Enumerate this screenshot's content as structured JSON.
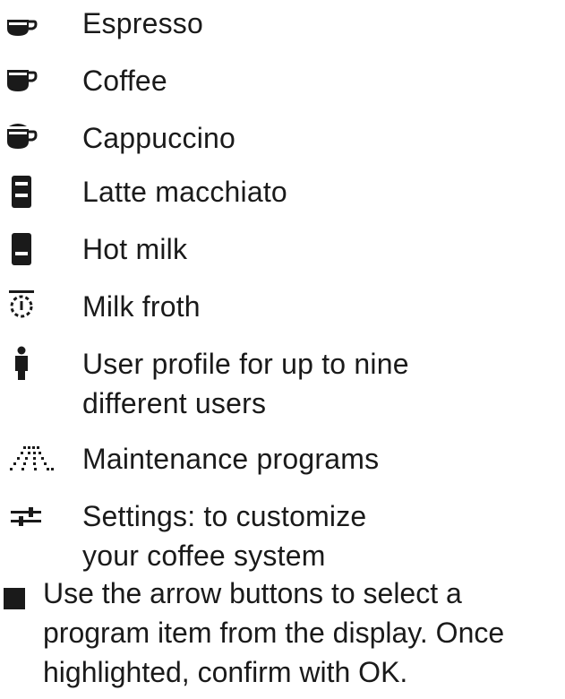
{
  "items": [
    {
      "icon": "espresso-cup-icon",
      "label": "Espresso"
    },
    {
      "icon": "coffee-cup-icon",
      "label": "Coffee"
    },
    {
      "icon": "cappuccino-cup-icon",
      "label": "Cappuccino"
    },
    {
      "icon": "latte-macchiato-glass-icon",
      "label": "Latte macchiato"
    },
    {
      "icon": "hot-milk-glass-icon",
      "label": "Hot milk"
    },
    {
      "icon": "milk-froth-icon",
      "label": "Milk froth"
    },
    {
      "icon": "user-profile-icon",
      "label_line1": "User profile for up to nine",
      "label_line2": "different users"
    },
    {
      "icon": "maintenance-icon",
      "label": "Maintenance programs"
    },
    {
      "icon": "settings-sliders-icon",
      "label_line1": "Settings: to customize",
      "label_line2": "your coffee system"
    }
  ],
  "instruction": {
    "line1": "Use the arrow buttons to select a",
    "line2": "program item from the display. Once",
    "line3": "highlighted, confirm with OK."
  }
}
